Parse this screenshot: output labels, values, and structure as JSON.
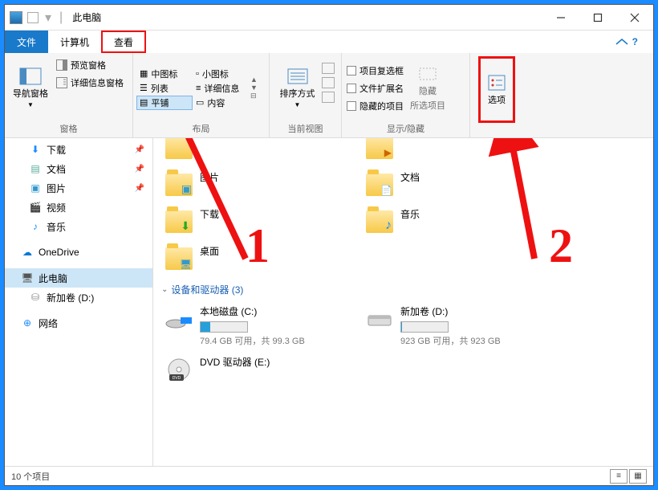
{
  "title": "此电脑",
  "tabs": {
    "file": "文件",
    "computer": "计算机",
    "view": "查看"
  },
  "ribbon": {
    "groups": {
      "panes": {
        "label": "窗格",
        "nav": "导航窗格",
        "preview": "预览窗格",
        "details": "详细信息窗格"
      },
      "layout": {
        "label": "布局",
        "medium": "中图标",
        "small": "小图标",
        "list": "列表",
        "details": "详细信息",
        "tiles": "平铺",
        "content": "内容"
      },
      "curview": {
        "label": "当前视图",
        "sort": "排序方式"
      },
      "showhide": {
        "label": "显示/隐藏",
        "itemcheck": "项目复选框",
        "ext": "文件扩展名",
        "hidden": "隐藏的项目",
        "hidesel": "隐藏",
        "hidesel2": "所选项目"
      },
      "options": {
        "label": "选项"
      }
    }
  },
  "sidebar": {
    "downloads": "下载",
    "documents": "文档",
    "pictures": "图片",
    "videos": "视频",
    "music": "音乐",
    "onedrive": "OneDrive",
    "thispc": "此电脑",
    "newvol": "新加卷 (D:)",
    "network": "网络"
  },
  "main": {
    "folders": {
      "pictures": "图片",
      "documents": "文档",
      "downloads": "下载",
      "music": "音乐",
      "desktop": "桌面"
    },
    "drives_header": "设备和驱动器 (3)",
    "drives": {
      "c": {
        "name": "本地磁盘 (C:)",
        "info": "79.4 GB 可用，共 99.3 GB",
        "fill": 20
      },
      "d": {
        "name": "新加卷 (D:)",
        "info": "923 GB 可用，共 923 GB",
        "fill": 1
      },
      "e": {
        "name": "DVD 驱动器 (E:)"
      }
    }
  },
  "status": "10 个项目",
  "annotations": {
    "num1": "1",
    "num2": "2"
  }
}
